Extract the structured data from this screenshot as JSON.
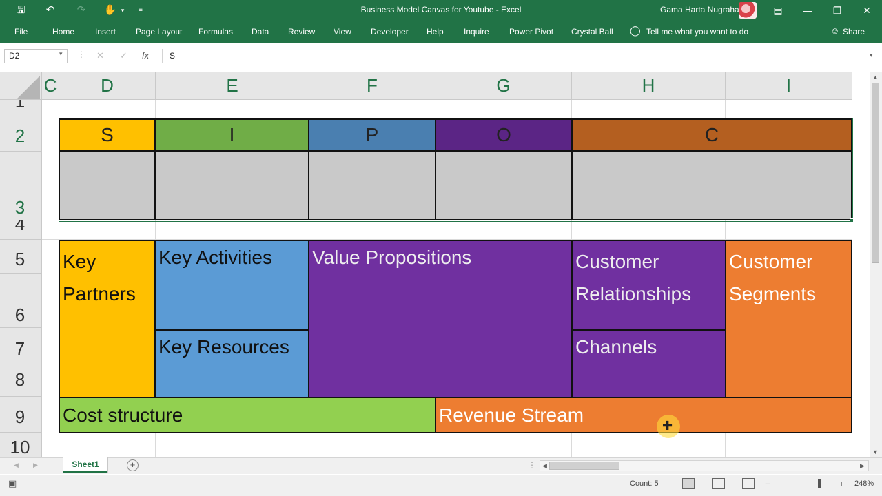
{
  "app": {
    "window_title": "Business Model Canvas for Youtube  -  Excel",
    "user_name": "Gama Harta Nugraha"
  },
  "ribbon": {
    "tabs": [
      "File",
      "Home",
      "Insert",
      "Page Layout",
      "Formulas",
      "Data",
      "Review",
      "View",
      "Developer",
      "Help",
      "Inquire",
      "Power Pivot",
      "Crystal Ball"
    ],
    "tell_me": "Tell me what you want to do",
    "share": "Share"
  },
  "formula_bar": {
    "name_box": "D2",
    "cancel": "✕",
    "enter": "✓",
    "fx": "fx",
    "content": "S"
  },
  "grid": {
    "column_headers": [
      "C",
      "D",
      "E",
      "F",
      "G",
      "H",
      "I"
    ],
    "row_headers": [
      "1",
      "2",
      "3",
      "4",
      "5",
      "6",
      "7",
      "8",
      "9",
      "10"
    ]
  },
  "sipoc": {
    "headers": [
      {
        "label": "S",
        "color": "#ffc000"
      },
      {
        "label": "I",
        "color": "#70ad47"
      },
      {
        "label": "P",
        "color": "#4a7fb0"
      },
      {
        "label": "O",
        "color": "#5b2585"
      },
      {
        "label": "C",
        "color": "#b45f20"
      }
    ],
    "body_color": "#c9c9c9"
  },
  "canvas": {
    "key_partners": {
      "label": "Key Partners",
      "color": "#ffc000"
    },
    "key_activities": {
      "label": "Key Activities",
      "color": "#5b9bd5"
    },
    "key_resources": {
      "label": "Key Resources",
      "color": "#5b9bd5"
    },
    "value_propositions": {
      "label": "Value Propositions",
      "color": "#7030a0"
    },
    "customer_relationships": {
      "label": "Customer Relationships",
      "color": "#7030a0"
    },
    "channels": {
      "label": "Channels",
      "color": "#7030a0"
    },
    "customer_segments": {
      "label": "Customer Segments",
      "color": "#ed7d31"
    },
    "cost_structure": {
      "label": "Cost structure",
      "color": "#92d050"
    },
    "revenue_stream": {
      "label": "Revenue Stream",
      "color": "#ed7d31"
    }
  },
  "sheets": {
    "active": "Sheet1",
    "add_label": "+"
  },
  "status": {
    "count": "Count: 5",
    "zoom": "248%",
    "zoom_minus": "−",
    "zoom_plus": "+"
  }
}
